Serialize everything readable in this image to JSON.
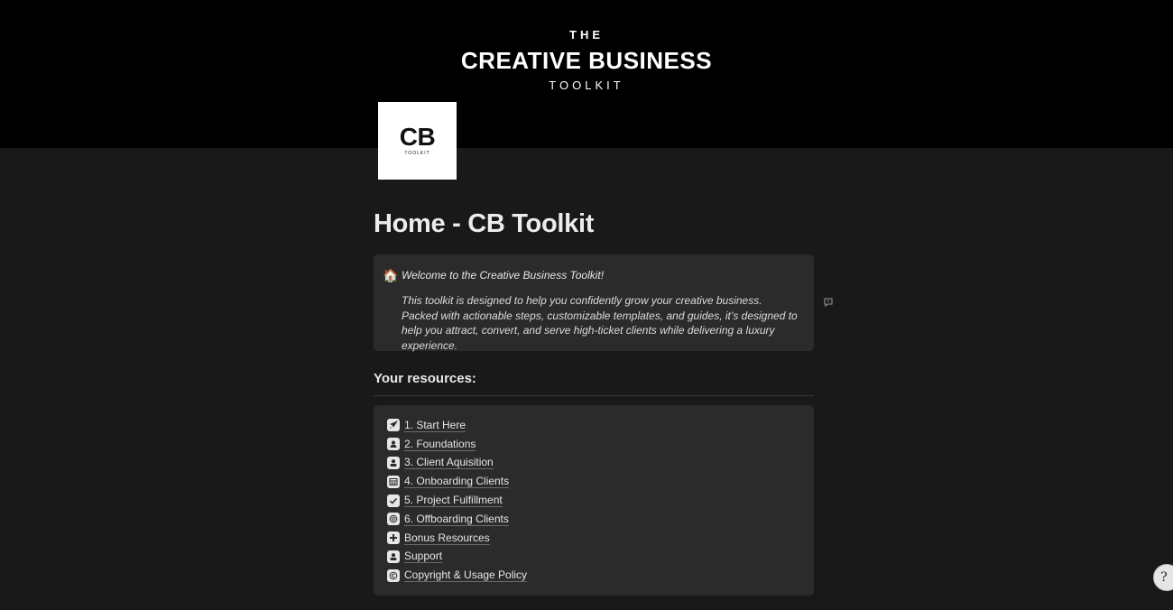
{
  "cover": {
    "line1": "THE",
    "line2": "CREATIVE BUSINESS",
    "line3": "TOOLKIT"
  },
  "logo": {
    "main": "CB",
    "sub": "TOOLKIT"
  },
  "page": {
    "title": "Home - CB Toolkit"
  },
  "callout": {
    "icon": "house-emoji",
    "icon_glyph": "🏠",
    "heading": "Welcome to the Creative Business Toolkit!",
    "body": "This toolkit is designed to help you confidently grow your creative business. Packed with actionable steps, customizable templates, and guides, it’s designed to help you attract, convert, and serve high-ticket clients while delivering a luxury experience."
  },
  "resources": {
    "heading": "Your resources:",
    "items": [
      {
        "label": "1. Start Here",
        "icon": "rocket-icon"
      },
      {
        "label": "2. Foundations",
        "icon": "person-icon"
      },
      {
        "label": "3. Client Aquisition",
        "icon": "user-icon"
      },
      {
        "label": "4. Onboarding Clients",
        "icon": "window-icon"
      },
      {
        "label": "5. Project Fulfillment",
        "icon": "checkmark-icon"
      },
      {
        "label": "6. Offboarding Clients",
        "icon": "globe-icon"
      },
      {
        "label": "Bonus Resources",
        "icon": "plus-icon"
      },
      {
        "label": "Support",
        "icon": "user-icon"
      },
      {
        "label": "Copyright & Usage Policy",
        "icon": "copyright-icon"
      }
    ]
  },
  "help": {
    "glyph": "?"
  },
  "colors": {
    "background": "#191919",
    "cover": "#000000",
    "card": "#2b2b2b",
    "text": "#e6e6e6"
  }
}
